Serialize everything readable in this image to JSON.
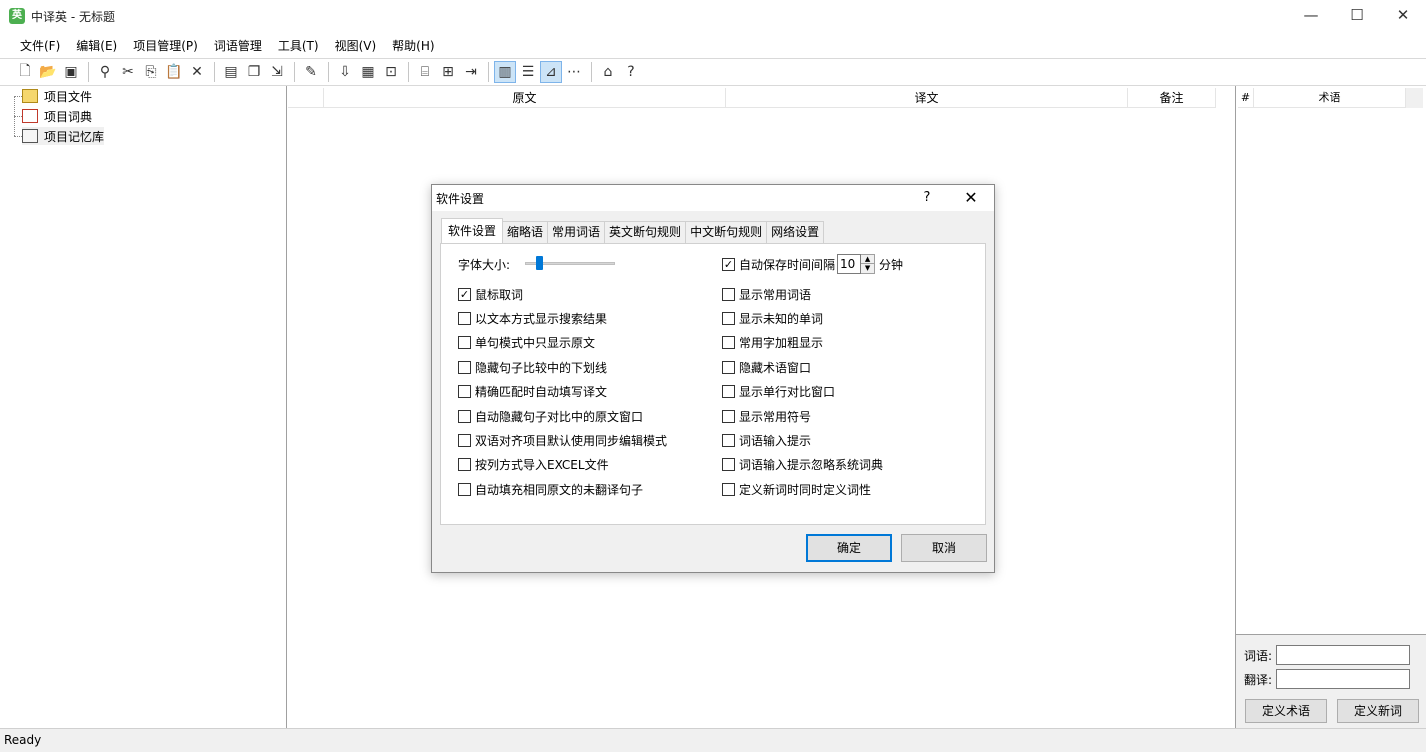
{
  "window": {
    "title": "中译英 - 无标题",
    "app_icon_text": "英",
    "minimize": "—",
    "maximize": "☐",
    "close": "✕"
  },
  "menu": [
    "文件(F)",
    "编辑(E)",
    "项目管理(P)",
    "词语管理",
    "工具(T)",
    "视图(V)",
    "帮助(H)"
  ],
  "tree": {
    "items": [
      {
        "label": "项目文件",
        "icon": "folder-icon",
        "icon_color": "#f5d76e"
      },
      {
        "label": "项目词典",
        "icon": "dictionary-icon",
        "icon_color": "#c0392b"
      },
      {
        "label": "项目记忆库",
        "icon": "memory-icon",
        "icon_color": "#f5f5f5"
      }
    ]
  },
  "grid": {
    "columns": [
      "原文",
      "译文",
      "备注"
    ]
  },
  "term_panel": {
    "columns": [
      "#",
      "术语"
    ],
    "word_label": "词语:",
    "translation_label": "翻译:",
    "word_value": "",
    "translation_value": "",
    "define_term_button": "定义术语",
    "define_word_button": "定义新词"
  },
  "status": {
    "text": "Ready"
  },
  "dialog": {
    "title": "软件设置",
    "help": "?",
    "close": "✕",
    "tabs": [
      "软件设置",
      "缩略语",
      "常用词语",
      "英文断句规则",
      "中文断句规则",
      "网络设置"
    ],
    "active_tab": 0,
    "font_size_label": "字体大小:",
    "font_size_level": 0.15,
    "autosave": {
      "label": "自动保存时间间隔",
      "value": "10",
      "unit": "分钟",
      "checked": true
    },
    "left_options": [
      {
        "label": "鼠标取词",
        "checked": true
      },
      {
        "label": "以文本方式显示搜索结果",
        "checked": false
      },
      {
        "label": "单句模式中只显示原文",
        "checked": false
      },
      {
        "label": "隐藏句子比较中的下划线",
        "checked": false
      },
      {
        "label": "精确匹配时自动填写译文",
        "checked": false
      },
      {
        "label": "自动隐藏句子对比中的原文窗口",
        "checked": false
      },
      {
        "label": "双语对齐项目默认使用同步编辑模式",
        "checked": false
      },
      {
        "label": "按列方式导入EXCEL文件",
        "checked": false
      },
      {
        "label": "自动填充相同原文的未翻译句子",
        "checked": false
      }
    ],
    "right_options": [
      {
        "label": "显示常用词语",
        "checked": false
      },
      {
        "label": "显示未知的单词",
        "checked": false
      },
      {
        "label": "常用字加粗显示",
        "checked": false
      },
      {
        "label": "隐藏术语窗口",
        "checked": false
      },
      {
        "label": "显示单行对比窗口",
        "checked": false
      },
      {
        "label": "显示常用符号",
        "checked": false
      },
      {
        "label": "词语输入提示",
        "checked": false
      },
      {
        "label": "词语输入提示忽略系统词典",
        "checked": false
      },
      {
        "label": "定义新词时同时定义词性",
        "checked": false
      }
    ],
    "ok_button": "确定",
    "cancel_button": "取消"
  },
  "toolbar": {
    "icons": [
      "new-file-icon",
      "open-folder-icon",
      "save-icon",
      "|",
      "find-icon",
      "cut-icon",
      "copy-icon",
      "paste-icon",
      "delete-icon",
      "|",
      "new-project-icon",
      "copy-project-icon",
      "export-icon",
      "|",
      "edit-icon",
      "|",
      "import-icon",
      "package-icon",
      "lock-icon",
      "|",
      "database-icon",
      "merge-icon",
      "import-arrow-icon",
      "|",
      "view-bilingual-icon",
      "view-list-icon",
      "view-compare-icon",
      "view-align-icon",
      "|",
      "home-icon",
      "help-icon"
    ],
    "glyphs": {
      "new-file-icon": "🗋",
      "open-folder-icon": "📂",
      "save-icon": "▣",
      "find-icon": "⚲",
      "cut-icon": "✂",
      "copy-icon": "⎘",
      "paste-icon": "📋",
      "delete-icon": "✕",
      "new-project-icon": "▤",
      "copy-project-icon": "❐",
      "export-icon": "⇲",
      "edit-icon": "✎",
      "import-icon": "⇩",
      "package-icon": "▦",
      "lock-icon": "⊡",
      "database-icon": "⌸",
      "merge-icon": "⊞",
      "import-arrow-icon": "⇥",
      "view-bilingual-icon": "▥",
      "view-list-icon": "☰",
      "view-compare-icon": "⊿",
      "view-align-icon": "⋯",
      "home-icon": "⌂",
      "help-icon": "?"
    },
    "pressed": [
      "view-bilingual-icon",
      "view-compare-icon"
    ]
  }
}
